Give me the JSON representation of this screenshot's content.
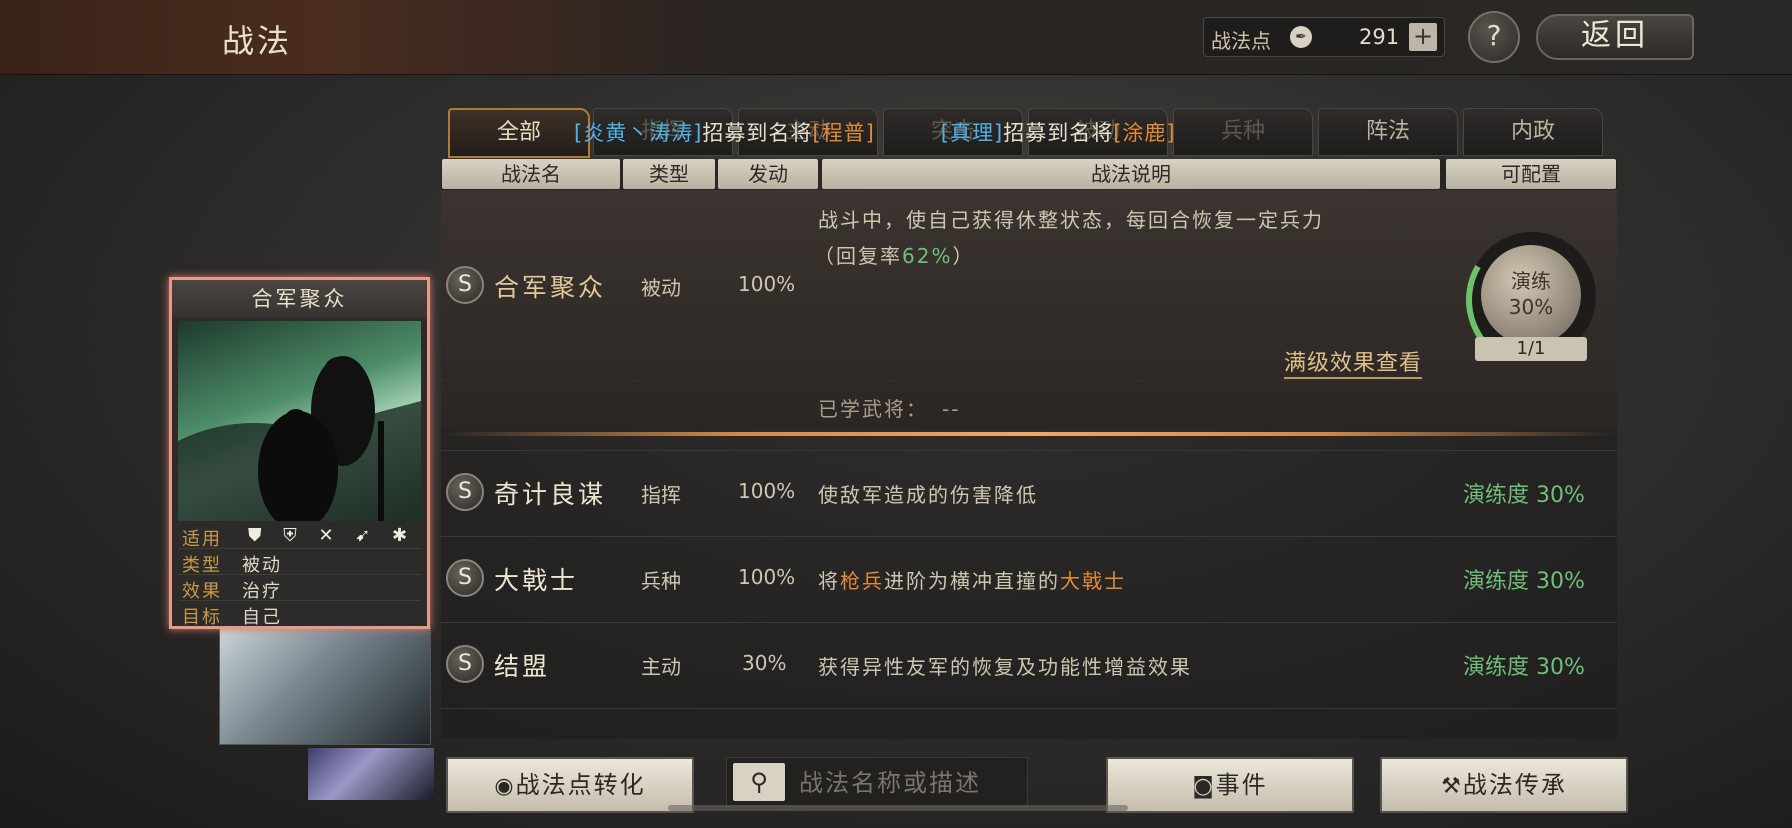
{
  "header": {
    "title": "战法",
    "points_label": "战法点",
    "points_value": "291",
    "points_plus": "+",
    "help": "?",
    "back_label": "返回"
  },
  "tabs": [
    {
      "label": "全部"
    },
    {
      "label": "指挥"
    },
    {
      "label": "主动"
    },
    {
      "label": "突击"
    },
    {
      "label": "被动"
    },
    {
      "label": "兵种"
    },
    {
      "label": "阵法"
    },
    {
      "label": "内政"
    }
  ],
  "ticker": {
    "p1_open": "[",
    "p1_name": "炎黄丶涛涛",
    "p1_close": "]",
    "p1_mid": "招募到名将",
    "p1_gen": "[程普]",
    "p2_open": "[",
    "p2_name": "真理",
    "p2_close": "]",
    "p2_mid": "招募到名将",
    "p2_gen": "[涂鹿]"
  },
  "table_headers": {
    "name": "战法名",
    "type": "类型",
    "trigger": "发动",
    "description": "战法说明",
    "configurable": "可配置"
  },
  "expanded": {
    "badge": "S",
    "name": "合军聚众",
    "type": "被动",
    "trigger": "100%",
    "desc_line1": "战斗中，使自己获得休整状态，每回合恢复一定兵力",
    "desc_line2_a": "（回复率",
    "desc_line2_pct": "62%",
    "desc_line2_b": "）",
    "drill_label": "演练",
    "drill_pct": "30%",
    "drill_count": "1/1",
    "max_effect_link": "满级效果查看",
    "learned_label": "已学武将：",
    "learned_value": "--"
  },
  "rows": [
    {
      "badge": "S",
      "name": "奇计良谋",
      "type": "指挥",
      "trigger": "100%",
      "desc": "使敌军造成的伤害降低",
      "drill": "演练度 30%"
    },
    {
      "badge": "S",
      "name": "大戟士",
      "type": "兵种",
      "trigger": "100%",
      "desc_a": "将",
      "desc_hl1": "枪兵",
      "desc_b": "进阶为横冲直撞的",
      "desc_hl2": "大戟士",
      "drill": "演练度 30%"
    },
    {
      "badge": "S",
      "name": "结盟",
      "type": "主动",
      "trigger": "30%",
      "desc": "获得异性友军的恢复及功能性增益效果",
      "drill": "演练度 30%"
    }
  ],
  "card": {
    "title": "合军聚众",
    "apply_label": "适用",
    "weapon_icons": "⛊ ⛨ ✕ ➹ ✱",
    "type_label": "类型",
    "type_value": "被动",
    "effect_label": "效果",
    "effect_value": "治疗",
    "target_label": "目标",
    "target_value": "自己"
  },
  "footer": {
    "convert_label": "战法点转化",
    "search_placeholder": "战法名称或描述",
    "event_label": "事件",
    "inherit_label": "战法传承"
  }
}
